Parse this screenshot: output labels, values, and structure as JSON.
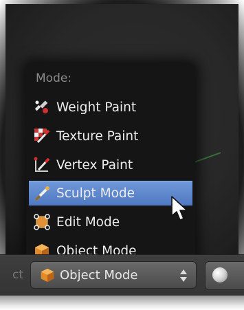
{
  "menu": {
    "title": "Mode:",
    "items": [
      {
        "label": "Weight Paint",
        "icon": "weight-paint-icon"
      },
      {
        "label": "Texture Paint",
        "icon": "texture-paint-icon"
      },
      {
        "label": "Vertex Paint",
        "icon": "vertex-paint-icon"
      },
      {
        "label": "Sculpt Mode",
        "icon": "sculpt-mode-icon",
        "highlighted": true
      },
      {
        "label": "Edit Mode",
        "icon": "edit-mode-icon"
      },
      {
        "label": "Object Mode",
        "icon": "object-mode-icon"
      }
    ]
  },
  "header": {
    "left_stub_text": "ct",
    "mode_select": {
      "value": "Object Mode",
      "icon": "object-mode-icon"
    },
    "shading_button": {
      "icon": "sphere-shading-icon"
    }
  },
  "colors": {
    "highlight": "#5a84c9",
    "menu_bg": "#151515",
    "text": "#ededed",
    "title_text": "#8a8a8a"
  }
}
